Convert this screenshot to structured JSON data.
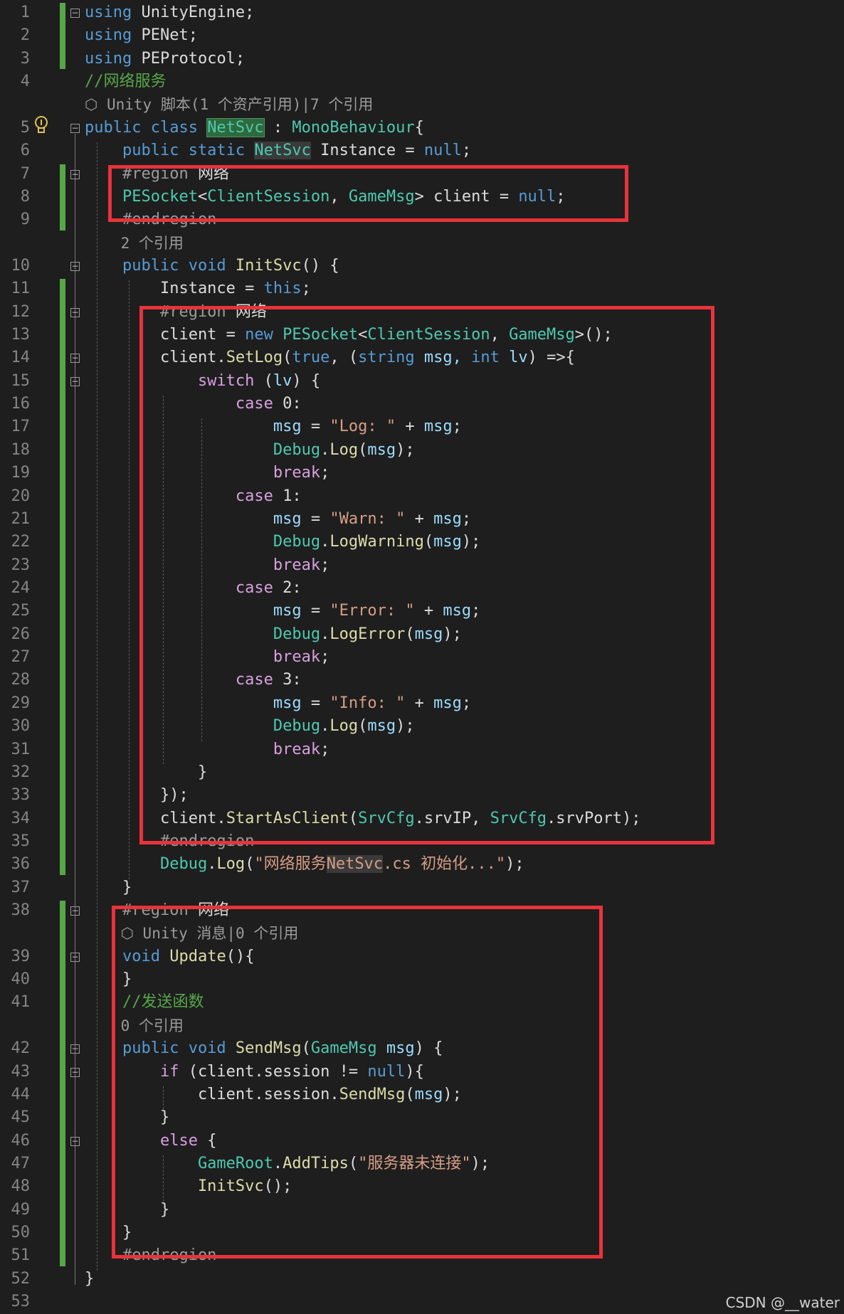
{
  "editor": {
    "lines": [
      {
        "number": "1",
        "segments": [
          {
            "t": "using",
            "c": "k"
          },
          {
            "t": " UnityEngine;",
            "c": ""
          }
        ]
      },
      {
        "number": "2",
        "segments": [
          {
            "t": "using",
            "c": "k"
          },
          {
            "t": " PENet;",
            "c": ""
          }
        ]
      },
      {
        "number": "3",
        "segments": [
          {
            "t": "using",
            "c": "k"
          },
          {
            "t": " PEProtocol;",
            "c": ""
          }
        ]
      },
      {
        "number": "4",
        "segments": [
          {
            "t": "//网络服务",
            "c": "c"
          }
        ]
      },
      {
        "number": "",
        "lens": true,
        "segments": [
          {
            "t": "⬡ Unity 脚本(1 个资产引用)|7 个引用",
            "c": "g"
          }
        ]
      },
      {
        "number": "5",
        "segments": [
          {
            "t": "public class ",
            "c": "k"
          },
          {
            "t": "NetSvc",
            "c": "t hl"
          },
          {
            "t": " : ",
            "c": ""
          },
          {
            "t": "MonoBehaviour",
            "c": "t"
          },
          {
            "t": "{",
            "c": ""
          }
        ]
      },
      {
        "number": "6",
        "segments": [
          {
            "t": "    public static ",
            "c": "k"
          },
          {
            "t": "NetSvc",
            "c": "t hl2"
          },
          {
            "t": " Instance = ",
            "c": ""
          },
          {
            "t": "null",
            "c": "k"
          },
          {
            "t": ";",
            "c": ""
          }
        ]
      },
      {
        "number": "7",
        "segments": [
          {
            "t": "    #region",
            "c": "g"
          },
          {
            "t": " 网络",
            "c": ""
          }
        ]
      },
      {
        "number": "8",
        "segments": [
          {
            "t": "    PESocket",
            "c": "t"
          },
          {
            "t": "<",
            "c": ""
          },
          {
            "t": "ClientSession",
            "c": "t"
          },
          {
            "t": ", ",
            "c": ""
          },
          {
            "t": "GameMsg",
            "c": "t"
          },
          {
            "t": "> client = ",
            "c": ""
          },
          {
            "t": "null",
            "c": "k"
          },
          {
            "t": ";",
            "c": ""
          }
        ]
      },
      {
        "number": "9",
        "segments": [
          {
            "t": "    #endregion",
            "c": "g"
          }
        ]
      },
      {
        "number": "",
        "lens": true,
        "segments": [
          {
            "t": "    2 个引用",
            "c": "g"
          }
        ]
      },
      {
        "number": "10",
        "segments": [
          {
            "t": "    public void ",
            "c": "k"
          },
          {
            "t": "InitSvc",
            "c": "m"
          },
          {
            "t": "() {",
            "c": ""
          }
        ]
      },
      {
        "number": "11",
        "segments": [
          {
            "t": "        Instance = ",
            "c": ""
          },
          {
            "t": "this",
            "c": "k"
          },
          {
            "t": ";",
            "c": ""
          }
        ]
      },
      {
        "number": "12",
        "segments": [
          {
            "t": "        #region",
            "c": "g"
          },
          {
            "t": " 网络",
            "c": ""
          }
        ]
      },
      {
        "number": "13",
        "segments": [
          {
            "t": "        client = ",
            "c": ""
          },
          {
            "t": "new ",
            "c": "k"
          },
          {
            "t": "PESocket",
            "c": "t"
          },
          {
            "t": "<",
            "c": ""
          },
          {
            "t": "ClientSession",
            "c": "t"
          },
          {
            "t": ", ",
            "c": ""
          },
          {
            "t": "GameMsg",
            "c": "t"
          },
          {
            "t": ">();",
            "c": ""
          }
        ]
      },
      {
        "number": "14",
        "segments": [
          {
            "t": "        client.",
            "c": ""
          },
          {
            "t": "SetLog",
            "c": "m"
          },
          {
            "t": "(",
            "c": ""
          },
          {
            "t": "true",
            "c": "k"
          },
          {
            "t": ", (",
            "c": ""
          },
          {
            "t": "string",
            "c": "k"
          },
          {
            "t": " msg, ",
            "c": "v"
          },
          {
            "t": "int",
            "c": "k"
          },
          {
            "t": " lv",
            "c": "v"
          },
          {
            "t": ") =>{",
            "c": ""
          }
        ]
      },
      {
        "number": "15",
        "segments": [
          {
            "t": "            switch",
            "c": "p"
          },
          {
            "t": " (",
            "c": ""
          },
          {
            "t": "lv",
            "c": "v"
          },
          {
            "t": ") {",
            "c": ""
          }
        ]
      },
      {
        "number": "16",
        "segments": [
          {
            "t": "                case",
            "c": "p"
          },
          {
            "t": " 0:",
            "c": ""
          }
        ]
      },
      {
        "number": "17",
        "segments": [
          {
            "t": "                    msg",
            "c": "v"
          },
          {
            "t": " = ",
            "c": ""
          },
          {
            "t": "\"Log: \"",
            "c": "s"
          },
          {
            "t": " + ",
            "c": ""
          },
          {
            "t": "msg",
            "c": "v"
          },
          {
            "t": ";",
            "c": ""
          }
        ]
      },
      {
        "number": "18",
        "segments": [
          {
            "t": "                    Debug",
            "c": "t"
          },
          {
            "t": ".",
            "c": ""
          },
          {
            "t": "Log",
            "c": "m"
          },
          {
            "t": "(",
            "c": ""
          },
          {
            "t": "msg",
            "c": "v"
          },
          {
            "t": ");",
            "c": ""
          }
        ]
      },
      {
        "number": "19",
        "segments": [
          {
            "t": "                    break",
            "c": "p"
          },
          {
            "t": ";",
            "c": ""
          }
        ]
      },
      {
        "number": "20",
        "segments": [
          {
            "t": "                case",
            "c": "p"
          },
          {
            "t": " 1:",
            "c": ""
          }
        ]
      },
      {
        "number": "21",
        "segments": [
          {
            "t": "                    msg",
            "c": "v"
          },
          {
            "t": " = ",
            "c": ""
          },
          {
            "t": "\"Warn: \"",
            "c": "s"
          },
          {
            "t": " + ",
            "c": ""
          },
          {
            "t": "msg",
            "c": "v"
          },
          {
            "t": ";",
            "c": ""
          }
        ]
      },
      {
        "number": "22",
        "segments": [
          {
            "t": "                    Debug",
            "c": "t"
          },
          {
            "t": ".",
            "c": ""
          },
          {
            "t": "LogWarning",
            "c": "m"
          },
          {
            "t": "(",
            "c": ""
          },
          {
            "t": "msg",
            "c": "v"
          },
          {
            "t": ");",
            "c": ""
          }
        ]
      },
      {
        "number": "23",
        "segments": [
          {
            "t": "                    break",
            "c": "p"
          },
          {
            "t": ";",
            "c": ""
          }
        ]
      },
      {
        "number": "24",
        "segments": [
          {
            "t": "                case",
            "c": "p"
          },
          {
            "t": " 2:",
            "c": ""
          }
        ]
      },
      {
        "number": "25",
        "segments": [
          {
            "t": "                    msg",
            "c": "v"
          },
          {
            "t": " = ",
            "c": ""
          },
          {
            "t": "\"Error: \"",
            "c": "s"
          },
          {
            "t": " + ",
            "c": ""
          },
          {
            "t": "msg",
            "c": "v"
          },
          {
            "t": ";",
            "c": ""
          }
        ]
      },
      {
        "number": "26",
        "segments": [
          {
            "t": "                    Debug",
            "c": "t"
          },
          {
            "t": ".",
            "c": ""
          },
          {
            "t": "LogError",
            "c": "m"
          },
          {
            "t": "(",
            "c": ""
          },
          {
            "t": "msg",
            "c": "v"
          },
          {
            "t": ");",
            "c": ""
          }
        ]
      },
      {
        "number": "27",
        "segments": [
          {
            "t": "                    break",
            "c": "p"
          },
          {
            "t": ";",
            "c": ""
          }
        ]
      },
      {
        "number": "28",
        "segments": [
          {
            "t": "                case",
            "c": "p"
          },
          {
            "t": " 3:",
            "c": ""
          }
        ]
      },
      {
        "number": "29",
        "segments": [
          {
            "t": "                    msg",
            "c": "v"
          },
          {
            "t": " = ",
            "c": ""
          },
          {
            "t": "\"Info: \"",
            "c": "s"
          },
          {
            "t": " + ",
            "c": ""
          },
          {
            "t": "msg",
            "c": "v"
          },
          {
            "t": ";",
            "c": ""
          }
        ]
      },
      {
        "number": "30",
        "segments": [
          {
            "t": "                    Debug",
            "c": "t"
          },
          {
            "t": ".",
            "c": ""
          },
          {
            "t": "Log",
            "c": "m"
          },
          {
            "t": "(",
            "c": ""
          },
          {
            "t": "msg",
            "c": "v"
          },
          {
            "t": ");",
            "c": ""
          }
        ]
      },
      {
        "number": "31",
        "segments": [
          {
            "t": "                    break",
            "c": "p"
          },
          {
            "t": ";",
            "c": ""
          }
        ]
      },
      {
        "number": "32",
        "segments": [
          {
            "t": "            }",
            "c": ""
          }
        ]
      },
      {
        "number": "33",
        "segments": [
          {
            "t": "        });",
            "c": ""
          }
        ]
      },
      {
        "number": "34",
        "segments": [
          {
            "t": "        client.",
            "c": ""
          },
          {
            "t": "StartAsClient",
            "c": "m"
          },
          {
            "t": "(",
            "c": ""
          },
          {
            "t": "SrvCfg",
            "c": "t"
          },
          {
            "t": ".srvIP, ",
            "c": ""
          },
          {
            "t": "SrvCfg",
            "c": "t"
          },
          {
            "t": ".srvPort);",
            "c": ""
          }
        ]
      },
      {
        "number": "35",
        "segments": [
          {
            "t": "        #endregion",
            "c": "g"
          }
        ]
      },
      {
        "number": "36",
        "segments": [
          {
            "t": "        Debug",
            "c": "t"
          },
          {
            "t": ".",
            "c": ""
          },
          {
            "t": "Log",
            "c": "m"
          },
          {
            "t": "(",
            "c": ""
          },
          {
            "t": "\"网络服务",
            "c": "s"
          },
          {
            "t": "NetSvc",
            "c": "s hl2"
          },
          {
            "t": ".cs 初始化...\"",
            "c": "s"
          },
          {
            "t": ");",
            "c": ""
          }
        ]
      },
      {
        "number": "37",
        "segments": [
          {
            "t": "    }",
            "c": ""
          }
        ]
      },
      {
        "number": "38",
        "segments": [
          {
            "t": "    #region",
            "c": "g"
          },
          {
            "t": " 网络",
            "c": ""
          }
        ]
      },
      {
        "number": "",
        "lens": true,
        "segments": [
          {
            "t": "    ⬡ Unity 消息|0 个引用",
            "c": "g"
          }
        ]
      },
      {
        "number": "39",
        "segments": [
          {
            "t": "    void ",
            "c": "k"
          },
          {
            "t": "Update",
            "c": "m"
          },
          {
            "t": "(){",
            "c": ""
          }
        ]
      },
      {
        "number": "40",
        "segments": [
          {
            "t": "    }",
            "c": ""
          }
        ]
      },
      {
        "number": "41",
        "segments": [
          {
            "t": "    //发送函数",
            "c": "c"
          }
        ]
      },
      {
        "number": "",
        "lens": true,
        "segments": [
          {
            "t": "    0 个引用",
            "c": "g"
          }
        ]
      },
      {
        "number": "42",
        "segments": [
          {
            "t": "    public void ",
            "c": "k"
          },
          {
            "t": "SendMsg",
            "c": "m"
          },
          {
            "t": "(",
            "c": ""
          },
          {
            "t": "GameMsg",
            "c": "t"
          },
          {
            "t": " msg",
            "c": "v"
          },
          {
            "t": ") {",
            "c": ""
          }
        ]
      },
      {
        "number": "43",
        "segments": [
          {
            "t": "        if",
            "c": "p"
          },
          {
            "t": " (client.session != ",
            "c": ""
          },
          {
            "t": "null",
            "c": "k"
          },
          {
            "t": "){",
            "c": ""
          }
        ]
      },
      {
        "number": "44",
        "segments": [
          {
            "t": "            client.session.",
            "c": ""
          },
          {
            "t": "SendMsg",
            "c": "m"
          },
          {
            "t": "(",
            "c": ""
          },
          {
            "t": "msg",
            "c": "v"
          },
          {
            "t": ");",
            "c": ""
          }
        ]
      },
      {
        "number": "45",
        "segments": [
          {
            "t": "        }",
            "c": ""
          }
        ]
      },
      {
        "number": "46",
        "segments": [
          {
            "t": "        else",
            "c": "p"
          },
          {
            "t": " {",
            "c": ""
          }
        ]
      },
      {
        "number": "47",
        "segments": [
          {
            "t": "            GameRoot",
            "c": "t"
          },
          {
            "t": ".",
            "c": ""
          },
          {
            "t": "AddTips",
            "c": "m"
          },
          {
            "t": "(",
            "c": ""
          },
          {
            "t": "\"服务器未连接\"",
            "c": "s"
          },
          {
            "t": ");",
            "c": ""
          }
        ]
      },
      {
        "number": "48",
        "segments": [
          {
            "t": "            InitSvc",
            "c": "m"
          },
          {
            "t": "();",
            "c": ""
          }
        ]
      },
      {
        "number": "49",
        "segments": [
          {
            "t": "        }",
            "c": ""
          }
        ]
      },
      {
        "number": "50",
        "segments": [
          {
            "t": "    }",
            "c": ""
          }
        ]
      },
      {
        "number": "51",
        "segments": [
          {
            "t": "    #endregion",
            "c": "g"
          }
        ]
      },
      {
        "number": "52",
        "segments": [
          {
            "t": "}",
            "c": ""
          }
        ]
      },
      {
        "number": "53",
        "segments": []
      }
    ],
    "fold_markers": [
      "1",
      "5",
      "7",
      "10",
      "12",
      "14",
      "15",
      "38",
      "39",
      "42",
      "43",
      "46"
    ],
    "change_bar_ranges": [
      [
        "1",
        "3"
      ],
      [
        "7",
        "9"
      ],
      [
        "11",
        "36"
      ],
      [
        "38",
        "51"
      ]
    ]
  },
  "colors": {
    "background": "#1e1e1e",
    "keyword": "#569cd6",
    "type": "#4ec9b0",
    "comment": "#57a64a",
    "string": "#d69d85",
    "method": "#dcdcaa",
    "variable": "#9cdcfe",
    "control": "#d8a0df",
    "annotation_box": "#e8333b",
    "change_bar": "#57a64a"
  },
  "icons": {
    "lightbulb": "lightbulb-icon",
    "unity": "unity-cube-icon",
    "fold": "collapse-toggle-icon"
  },
  "watermark": "CSDN @__water"
}
